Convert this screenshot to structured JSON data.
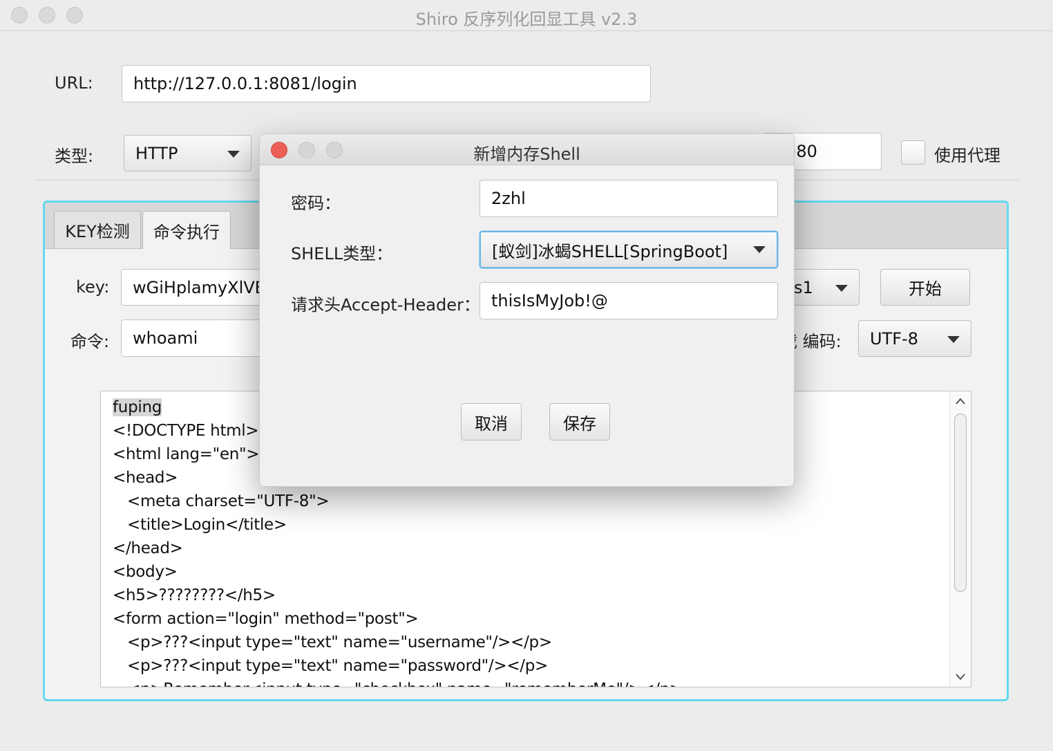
{
  "window": {
    "title": "Shiro 反序列化回显工具 v2.3"
  },
  "main": {
    "url_label": "URL:",
    "url_value": "http://127.0.0.1:8081/login",
    "type_label": "类型:",
    "type_value": "HTTP",
    "port_partial": ")80",
    "proxy_label": "使用代理"
  },
  "tabs": [
    {
      "label": "KEY检测"
    },
    {
      "label": "命令执行"
    }
  ],
  "command_tab": {
    "key_label": "key:",
    "key_value": "wGiHplamyXlVB",
    "cmd_label": "命令:",
    "cmd_value": "whoami",
    "gadget_partial": "s1",
    "start_button": "开始",
    "encoding_label": "载 编码:",
    "encoding_value": "UTF-8"
  },
  "output": {
    "lines": [
      "fuping",
      "<!DOCTYPE html>",
      "<html lang=\"en\">",
      "<head>",
      "   <meta charset=\"UTF-8\">",
      "   <title>Login</title>",
      "</head>",
      "<body>",
      "<h5>????????</h5>",
      "<form action=\"login\" method=\"post\">",
      "   <p>???<input type=\"text\" name=\"username\"/></p>",
      "   <p>???<input type=\"text\" name=\"password\"/></p>",
      "   <p>Remember<input type=\"checkbox\" name=\"rememberMe\"/></p>"
    ]
  },
  "dialog": {
    "title": "新增内存Shell",
    "password_label": "密码：",
    "password_value": "2zhl",
    "shell_type_label": "SHELL类型：",
    "shell_type_value": "[蚁剑]冰蝎SHELL[SpringBoot]",
    "header_label": "请求头Accept-Header：",
    "header_value": "thisIsMyJob!@",
    "cancel_button": "取消",
    "save_button": "保存"
  }
}
